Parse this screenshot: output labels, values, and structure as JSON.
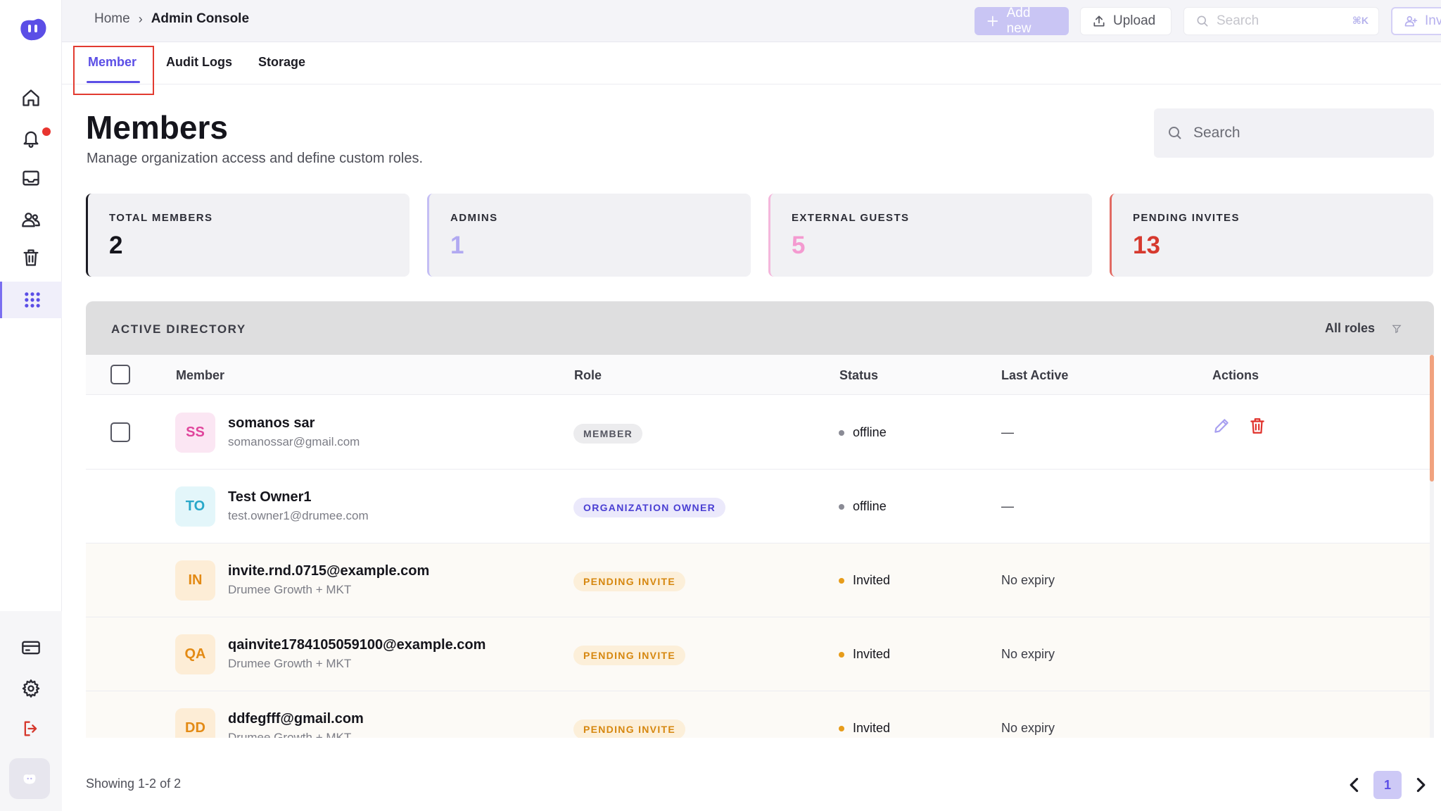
{
  "topbar": {
    "breadcrumb_home": "Home",
    "breadcrumb_sep": "›",
    "breadcrumb_current": "Admin Console",
    "add_new_label": "Add new",
    "upload_label": "Upload",
    "search_placeholder": "Search",
    "search_shortcut": "⌘K",
    "invite_label": "Invite"
  },
  "tabs": [
    {
      "label": "Member",
      "active": true
    },
    {
      "label": "Audit Logs",
      "active": false
    },
    {
      "label": "Storage",
      "active": false
    }
  ],
  "header": {
    "title": "Members",
    "subtitle": "Manage organization access and define custom roles.",
    "search_placeholder": "Search"
  },
  "stats": [
    {
      "label": "TOTAL MEMBERS",
      "value": "2",
      "color": "#15151c",
      "accent": "#1c1c24"
    },
    {
      "label": "ADMINS",
      "value": "1",
      "color": "#b1a9f1",
      "accent": "#c4bef4"
    },
    {
      "label": "EXTERNAL GUESTS",
      "value": "5",
      "color": "#f49ad0",
      "accent": "#f4b7dc"
    },
    {
      "label": "PENDING INVITES",
      "value": "13",
      "color": "#d6392e",
      "accent": "#e26a62"
    }
  ],
  "directory": {
    "title": "ACTIVE DIRECTORY",
    "filter_label": "All roles",
    "columns": {
      "member": "Member",
      "role": "Role",
      "status": "Status",
      "last_active": "Last Active",
      "actions": "Actions"
    },
    "rows": [
      {
        "initials": "SS",
        "name": "somanos sar",
        "sub": "somanossar@gmail.com",
        "role": "MEMBER",
        "status": "offline",
        "last_active": "—"
      },
      {
        "initials": "TO",
        "name": "Test Owner1",
        "sub": "test.owner1@drumee.com",
        "role": "ORGANIZATION OWNER",
        "status": "offline",
        "last_active": "—"
      },
      {
        "initials": "IN",
        "name": "invite.rnd.0715@example.com",
        "sub": "Drumee Growth + MKT",
        "role": "PENDING INVITE",
        "status": "Invited",
        "last_active": "No expiry"
      },
      {
        "initials": "QA",
        "name": "qainvite1784105059100@example.com",
        "sub": "Drumee Growth + MKT",
        "role": "PENDING INVITE",
        "status": "Invited",
        "last_active": "No expiry"
      },
      {
        "initials": "DD",
        "name": "ddfegfff@gmail.com",
        "sub": "Drumee Growth + MKT",
        "role": "PENDING INVITE",
        "status": "Invited",
        "last_active": "No expiry"
      }
    ]
  },
  "footer": {
    "showing": "Showing 1-2 of 2",
    "current_page": "1"
  },
  "colors": {
    "accent": "#5b4ee6",
    "danger": "#d6392e",
    "pending": "#e79c1a"
  }
}
